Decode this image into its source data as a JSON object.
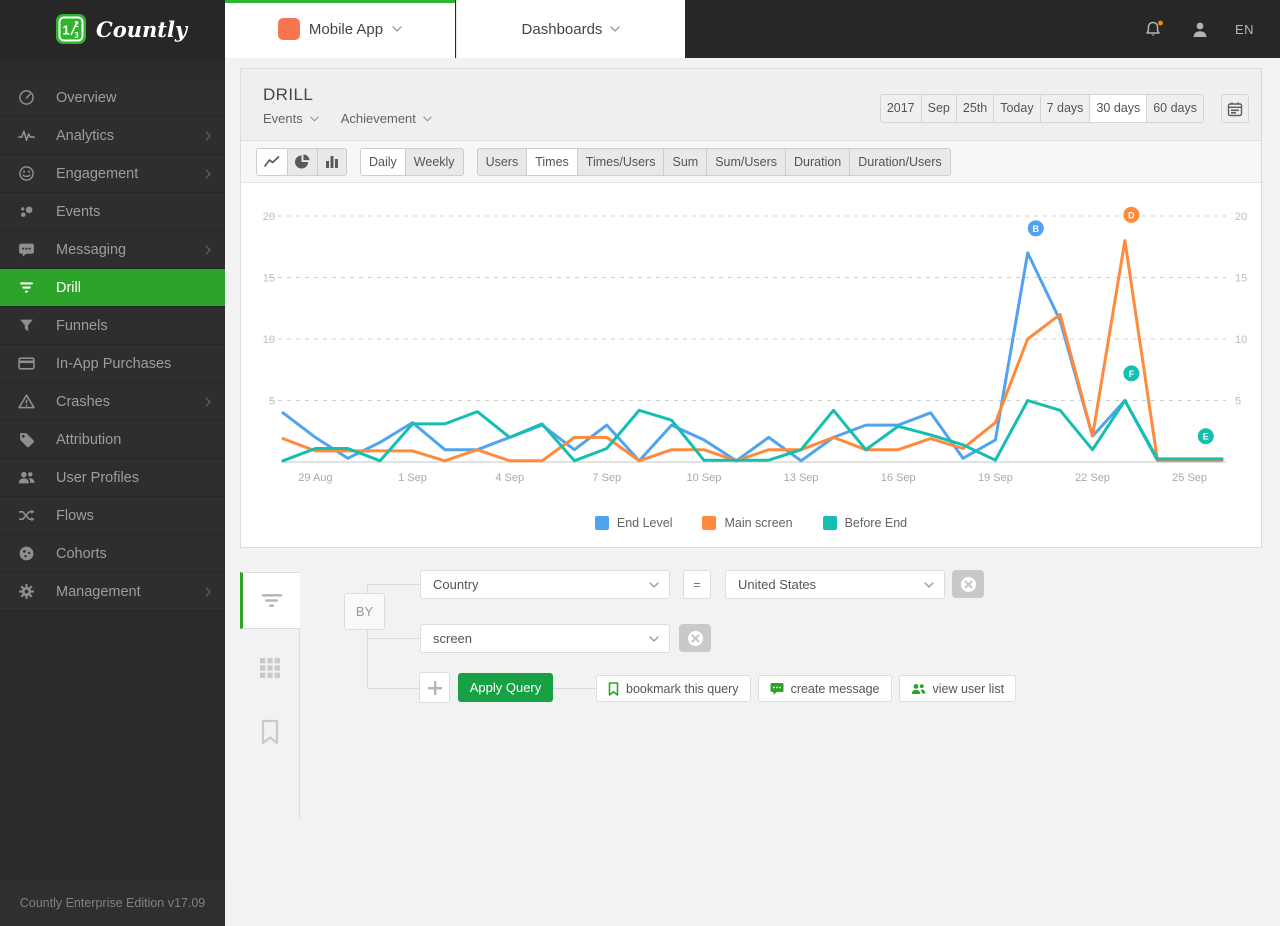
{
  "brand": {
    "name": "Countly",
    "footer": "Countly Enterprise Edition v17.09"
  },
  "topbar": {
    "app_selector_label": "Mobile App",
    "dashboards_label": "Dashboards",
    "language": "EN",
    "app_color": "#F87552",
    "notification_dot_color": "#FF8700"
  },
  "sidebar": {
    "items": [
      {
        "label": "Overview",
        "icon": "overview",
        "expandable": false,
        "active": false
      },
      {
        "label": "Analytics",
        "icon": "analytics",
        "expandable": true,
        "active": false
      },
      {
        "label": "Engagement",
        "icon": "engagement",
        "expandable": true,
        "active": false
      },
      {
        "label": "Events",
        "icon": "events",
        "expandable": false,
        "active": false
      },
      {
        "label": "Messaging",
        "icon": "messaging",
        "expandable": true,
        "active": false
      },
      {
        "label": "Drill",
        "icon": "drill",
        "expandable": false,
        "active": true
      },
      {
        "label": "Funnels",
        "icon": "funnels",
        "expandable": false,
        "active": false
      },
      {
        "label": "In-App Purchases",
        "icon": "purchases",
        "expandable": false,
        "active": false
      },
      {
        "label": "Crashes",
        "icon": "crashes",
        "expandable": true,
        "active": false
      },
      {
        "label": "Attribution",
        "icon": "attribution",
        "expandable": false,
        "active": false
      },
      {
        "label": "User Profiles",
        "icon": "user-profiles",
        "expandable": false,
        "active": false
      },
      {
        "label": "Flows",
        "icon": "flows",
        "expandable": false,
        "active": false
      },
      {
        "label": "Cohorts",
        "icon": "cohorts",
        "expandable": false,
        "active": false
      },
      {
        "label": "Management",
        "icon": "management",
        "expandable": true,
        "active": false
      }
    ]
  },
  "panel": {
    "title": "DRILL",
    "selectors": [
      {
        "label": "Events"
      },
      {
        "label": "Achievement"
      }
    ],
    "chart_types": [
      {
        "id": "line",
        "selected": true
      },
      {
        "id": "pie",
        "selected": false
      },
      {
        "id": "bar",
        "selected": false
      }
    ],
    "period_buttons": [
      {
        "label": "Daily",
        "selected": true
      },
      {
        "label": "Weekly",
        "selected": false
      }
    ],
    "metric_buttons": [
      {
        "label": "Users",
        "selected": false
      },
      {
        "label": "Times",
        "selected": true
      },
      {
        "label": "Times/Users",
        "selected": false
      },
      {
        "label": "Sum",
        "selected": false
      },
      {
        "label": "Sum/Users",
        "selected": false
      },
      {
        "label": "Duration",
        "selected": false
      },
      {
        "label": "Duration/Users",
        "selected": false
      }
    ],
    "date_buttons": [
      {
        "label": "2017",
        "selected": false
      },
      {
        "label": "Sep",
        "selected": false
      },
      {
        "label": "25th",
        "selected": false
      },
      {
        "label": "Today",
        "selected": false
      },
      {
        "label": "7 days",
        "selected": false
      },
      {
        "label": "30 days",
        "selected": true
      },
      {
        "label": "60 days",
        "selected": false
      }
    ]
  },
  "chart_data": {
    "type": "line",
    "x": [
      "28 Aug",
      "29 Aug",
      "30 Aug",
      "31 Aug",
      "1 Sep",
      "2 Sep",
      "3 Sep",
      "4 Sep",
      "5 Sep",
      "6 Sep",
      "7 Sep",
      "8 Sep",
      "9 Sep",
      "10 Sep",
      "11 Sep",
      "12 Sep",
      "13 Sep",
      "14 Sep",
      "15 Sep",
      "16 Sep",
      "17 Sep",
      "18 Sep",
      "19 Sep",
      "20 Sep",
      "21 Sep",
      "22 Sep",
      "23 Sep",
      "24 Sep",
      "25 Sep",
      "26 Sep"
    ],
    "x_label_indices": [
      1,
      4,
      7,
      10,
      13,
      16,
      19,
      22,
      25,
      28
    ],
    "x_labels": [
      "29 Aug",
      "1 Sep",
      "4 Sep",
      "7 Sep",
      "10 Sep",
      "13 Sep",
      "16 Sep",
      "19 Sep",
      "22 Sep",
      "25 Sep"
    ],
    "series": [
      {
        "name": "End Level",
        "color": "#52A3EF",
        "values": [
          4,
          2,
          0.3,
          1.6,
          3.2,
          1,
          1,
          2,
          3,
          1,
          3,
          0.1,
          3,
          1.8,
          0.1,
          2,
          0.1,
          2,
          3,
          3,
          4,
          0.3,
          1.8,
          17,
          11.5,
          2.1,
          5,
          0.15,
          0.15,
          0.15
        ]
      },
      {
        "name": "Main screen",
        "color": "#FF8A3C",
        "values": [
          1.9,
          0.9,
          0.9,
          0.9,
          0.9,
          0.1,
          1,
          0.1,
          0.1,
          2,
          2,
          0.1,
          1,
          1,
          0.1,
          1,
          1,
          2,
          1,
          1,
          1.9,
          1.1,
          3.2,
          10,
          12,
          2.1,
          18,
          0.2,
          0.2,
          0.2
        ]
      },
      {
        "name": "Before End",
        "color": "#14BFB0",
        "values": [
          0.1,
          1.1,
          1.1,
          0.1,
          3.1,
          3.1,
          4.1,
          2,
          3.1,
          0.1,
          1.1,
          4.2,
          3.4,
          0.15,
          0.15,
          0.15,
          1,
          4.2,
          1,
          2.9,
          2.2,
          1.4,
          0.15,
          5,
          4.2,
          1,
          5,
          0.25,
          0.25,
          0.25
        ]
      }
    ],
    "yticks": [
      5,
      10,
      15,
      20
    ],
    "ylim": [
      0,
      21
    ],
    "grid": "dashed-horizontal",
    "legend_position": "bottom",
    "annotations": [
      {
        "letter": "B",
        "color": "#52A3EF",
        "x": 23.25,
        "y": 19.0
      },
      {
        "letter": "D",
        "color": "#FF8A3C",
        "x": 26.2,
        "y": 20.1
      },
      {
        "letter": "F",
        "color": "#14BFB0",
        "x": 26.2,
        "y": 7.2
      },
      {
        "letter": "E",
        "color": "#14BFB0",
        "x": 28.5,
        "y": 2.1
      }
    ]
  },
  "query_builder": {
    "by_label": "BY",
    "filter_row": {
      "field": "Country",
      "operator": "=",
      "value": "United States"
    },
    "segment_row": {
      "field": "screen"
    },
    "apply_label": "Apply Query",
    "actions": [
      {
        "label": "bookmark this query",
        "icon": "bookmark"
      },
      {
        "label": "create message",
        "icon": "message"
      },
      {
        "label": "view user list",
        "icon": "users"
      }
    ]
  },
  "colors": {
    "accent_green": "#2DA32A",
    "button_green": "#18A045"
  }
}
